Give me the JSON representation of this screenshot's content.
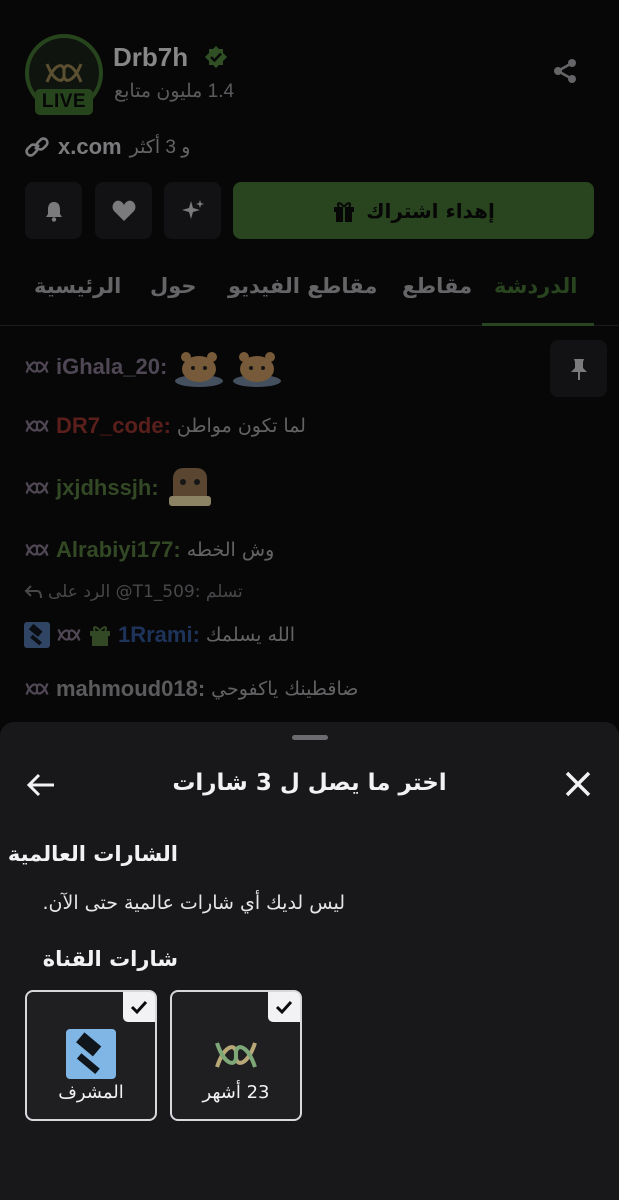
{
  "header": {
    "channel_name": "Drb7h",
    "live_label": "LIVE",
    "followers": "1.4 مليون متابع",
    "link_text": "x.com",
    "link_more": "و 3 أكثر",
    "subscribe_label": "إهداء اشتراك"
  },
  "tabs": [
    {
      "label": "الدردشة",
      "active": true
    },
    {
      "label": "مقاطع"
    },
    {
      "label": "مقاطع الفيديو"
    },
    {
      "label": "حول"
    },
    {
      "label": "الرئيسية"
    }
  ],
  "chat": {
    "messages": [
      {
        "user": "iGhala_20:",
        "text": "",
        "color": "#7a6e82"
      },
      {
        "user": "DR7_code:",
        "text": "لما تكون مواطن",
        "color": "#8a2f2a"
      },
      {
        "user": "jxjdhssjh:",
        "text": "",
        "color": "#4f6f38"
      },
      {
        "user": "Alrabiyi177:",
        "text": "وش الخطه",
        "color": "#4f6f38"
      },
      {
        "user": "1Rrami:",
        "text": "الله يسلمك",
        "color": "#2f4f8a"
      },
      {
        "user": "mahmoud018:",
        "text": "ضاقطينك ياكفوحي",
        "color": "#8c8c90"
      }
    ],
    "reply": "تسلم :T1_509@ الرد على"
  },
  "sheet": {
    "title": "اختر ما يصل ل 3 شارات",
    "global_badges_label": "الشارات العالمية",
    "global_badges_empty": "ليس لديك أي شارات عالمية حتى الآن.",
    "channel_badges_label": "شارات القناة",
    "badges": [
      {
        "label": "المشرف",
        "icon": "moderator-gavel-icon",
        "selected": true
      },
      {
        "label": "23 أشهر",
        "icon": "subscriber-badge-icon",
        "selected": true
      }
    ]
  },
  "colors": {
    "accent": "#3f6a30",
    "sheet_bg": "#18181b"
  }
}
